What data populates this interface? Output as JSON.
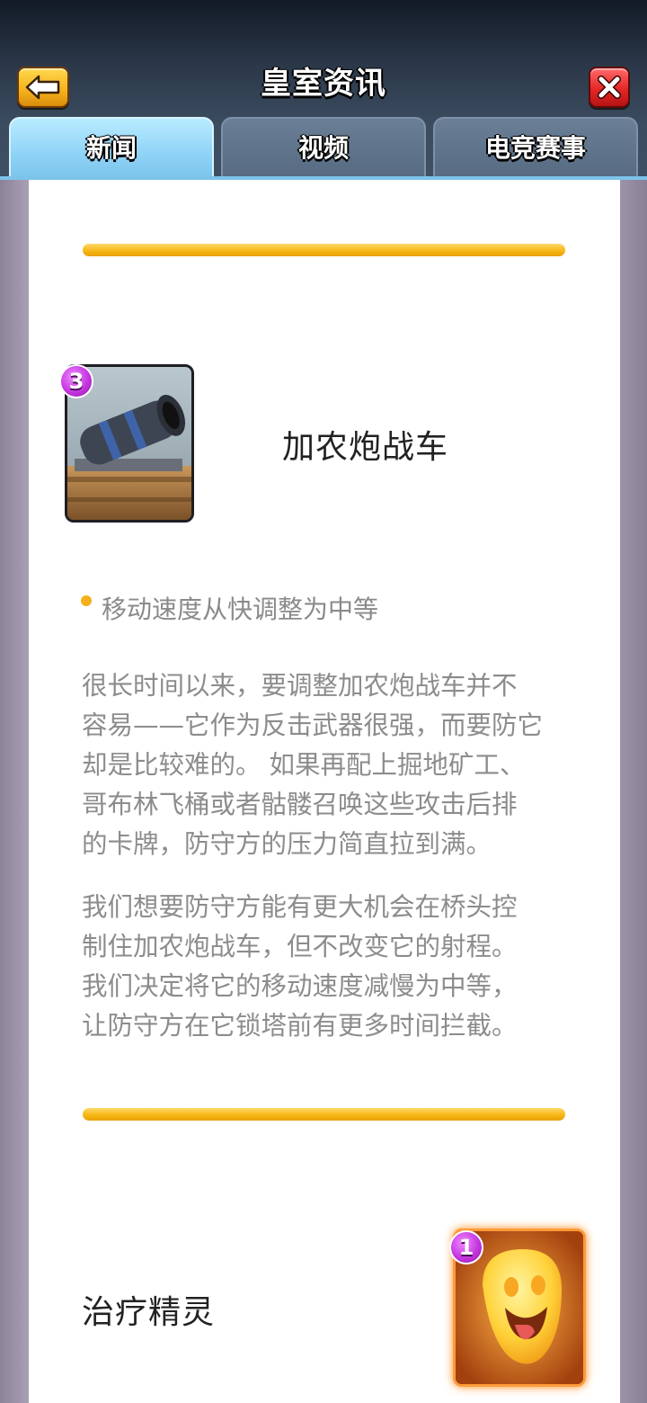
{
  "header": {
    "title": "皇室资讯",
    "back_icon": "back-arrow-icon",
    "close_icon": "close-x-icon"
  },
  "tabs": [
    {
      "label": "新闻",
      "active": true
    },
    {
      "label": "视频",
      "active": false
    },
    {
      "label": "电竞赛事",
      "active": false
    }
  ],
  "colors": {
    "accent_gold": "#f5b11b",
    "tab_active": "#8fd3f7",
    "close_red": "#e52626",
    "elixir_purple": "#c637e0"
  },
  "articles": [
    {
      "card_name": "加农炮战车",
      "elixir_cost": "3",
      "change_note": "移动速度从快调整为中等",
      "paragraphs": [
        [
          "很长时间以来，要调整加农炮战车并不",
          "容易——它作为反击武器很强，而要防它",
          "却是比较难的。 如果再配上掘地矿工、",
          "哥布林飞桶或者骷髅召唤这些攻击后排",
          "的卡牌，防守方的压力简直拉到满。"
        ],
        [
          "我们想要防守方能有更大机会在桥头控",
          "制住加农炮战车，但不改变它的射程。",
          "我们决定将它的移动速度减慢为中等，",
          "让防守方在它锁塔前有更多时间拦截。"
        ]
      ]
    },
    {
      "card_name": "治疗精灵",
      "elixir_cost": "1"
    }
  ]
}
